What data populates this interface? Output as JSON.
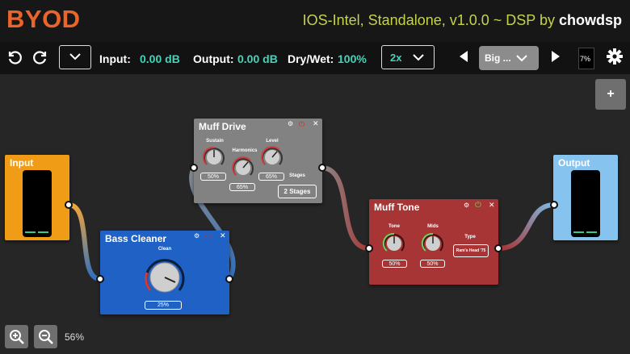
{
  "app": {
    "logo": "BYOD"
  },
  "header": {
    "subtitle": "IOS-Intel, Standalone, v1.0.0 ~ DSP by ",
    "brand": "chowdsp"
  },
  "toolbar": {
    "input_label": "Input:",
    "input_value": "0.00 dB",
    "output_label": "Output:",
    "output_value": "0.00 dB",
    "drywet_label": "Dry/Wet:",
    "drywet_value": "100%",
    "oversampling": "2x",
    "preset": "Big ...",
    "cpu": "7%"
  },
  "canvas": {
    "add_label": "+",
    "zoom": "56%"
  },
  "blocks": {
    "input": {
      "title": "Input"
    },
    "output": {
      "title": "Output"
    },
    "bass_cleaner": {
      "title": "Bass Cleaner",
      "knob_label": "Clean",
      "knob_value": "25%"
    },
    "muff_drive": {
      "title": "Muff Drive",
      "sustain_label": "Sustain",
      "sustain_value": "50%",
      "harmonics_label": "Harmonics",
      "harmonics_value": "65%",
      "level_label": "Level",
      "level_value": "65%",
      "stages_label": "Stages",
      "stages_value": "2 Stages"
    },
    "muff_tone": {
      "title": "Muff Tone",
      "tone_label": "Tone",
      "tone_value": "50%",
      "mids_label": "Mids",
      "mids_value": "50%",
      "type_label": "Type",
      "type_value": "Ram's Head '75"
    }
  }
}
